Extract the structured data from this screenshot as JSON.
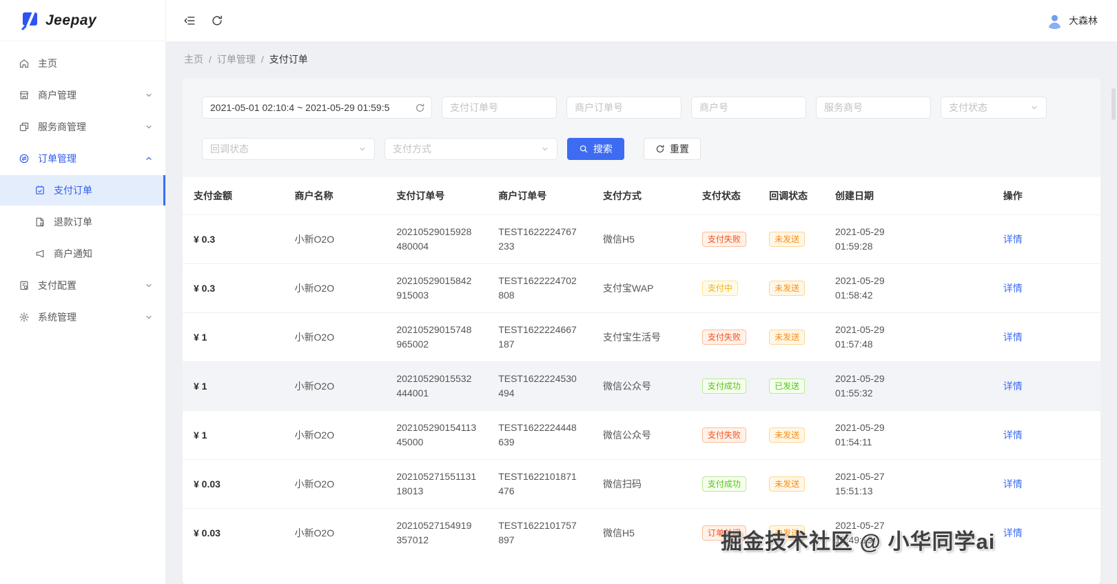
{
  "brand": {
    "name": "Jeepay"
  },
  "topbar": {
    "username": "大森林"
  },
  "breadcrumb": {
    "separator": "/",
    "items": [
      "主页",
      "订单管理",
      "支付订单"
    ]
  },
  "sidebar": {
    "items": [
      {
        "label": "主页"
      },
      {
        "label": "商户管理"
      },
      {
        "label": "服务商管理"
      },
      {
        "label": "订单管理",
        "children": [
          {
            "label": "支付订单"
          },
          {
            "label": "退款订单"
          },
          {
            "label": "商户通知"
          }
        ]
      },
      {
        "label": "支付配置"
      },
      {
        "label": "系统管理"
      }
    ]
  },
  "filters": {
    "date_range_value": "2021-05-01 02:10:4 ~ 2021-05-29 01:59:5",
    "pay_order_no_placeholder": "支付订单号",
    "mch_order_no_placeholder": "商户订单号",
    "mch_no_placeholder": "商户号",
    "isv_no_placeholder": "服务商号",
    "pay_status_placeholder": "支付状态",
    "notify_status_placeholder": "回调状态",
    "pay_way_placeholder": "支付方式",
    "search_label": "搜索",
    "reset_label": "重置"
  },
  "table": {
    "columns": [
      "支付金额",
      "商户名称",
      "支付订单号",
      "商户订单号",
      "支付方式",
      "支付状态",
      "回调状态",
      "创建日期",
      "操作"
    ],
    "action_label": "详情",
    "rows": [
      {
        "amount": "¥ 0.3",
        "merchant": "小新O2O",
        "pay_order_no": "20210529015928480004",
        "mch_order_no": "TEST1622224767233",
        "pay_way": "微信H5",
        "pay_status": {
          "text": "支付失败",
          "type": "error"
        },
        "notify_status": {
          "text": "未发送",
          "type": "warning"
        },
        "created_date": "2021-05-29",
        "created_time": "01:59:28"
      },
      {
        "amount": "¥ 0.3",
        "merchant": "小新O2O",
        "pay_order_no": "20210529015842915003",
        "mch_order_no": "TEST1622224702808",
        "pay_way": "支付宝WAP",
        "pay_status": {
          "text": "支付中",
          "type": "gold"
        },
        "notify_status": {
          "text": "未发送",
          "type": "warning"
        },
        "created_date": "2021-05-29",
        "created_time": "01:58:42"
      },
      {
        "amount": "¥ 1",
        "merchant": "小新O2O",
        "pay_order_no": "20210529015748965002",
        "mch_order_no": "TEST1622224667187",
        "pay_way": "支付宝生活号",
        "pay_status": {
          "text": "支付失败",
          "type": "error"
        },
        "notify_status": {
          "text": "未发送",
          "type": "warning"
        },
        "created_date": "2021-05-29",
        "created_time": "01:57:48"
      },
      {
        "amount": "¥ 1",
        "merchant": "小新O2O",
        "pay_order_no": "20210529015532444001",
        "mch_order_no": "TEST1622224530494",
        "pay_way": "微信公众号",
        "pay_status": {
          "text": "支付成功",
          "type": "success"
        },
        "notify_status": {
          "text": "已发送",
          "type": "success"
        },
        "created_date": "2021-05-29",
        "created_time": "01:55:32"
      },
      {
        "amount": "¥ 1",
        "merchant": "小新O2O",
        "pay_order_no": "20210529015411345000",
        "mch_order_no": "TEST1622224448639",
        "pay_way": "微信公众号",
        "pay_status": {
          "text": "支付失败",
          "type": "error"
        },
        "notify_status": {
          "text": "未发送",
          "type": "warning"
        },
        "created_date": "2021-05-29",
        "created_time": "01:54:11"
      },
      {
        "amount": "¥ 0.03",
        "merchant": "小新O2O",
        "pay_order_no": "20210527155113118013",
        "mch_order_no": "TEST1622101871476",
        "pay_way": "微信扫码",
        "pay_status": {
          "text": "支付成功",
          "type": "success"
        },
        "notify_status": {
          "text": "未发送",
          "type": "warning"
        },
        "created_date": "2021-05-27",
        "created_time": "15:51:13"
      },
      {
        "amount": "¥ 0.03",
        "merchant": "小新O2O",
        "pay_order_no": "20210527154919357012",
        "mch_order_no": "TEST1622101757897",
        "pay_way": "微信H5",
        "pay_status": {
          "text": "订单关闭",
          "type": "error"
        },
        "notify_status": {
          "text": "未发送",
          "type": "warning"
        },
        "created_date": "2021-05-27",
        "created_time": "15:49:19"
      }
    ]
  },
  "watermark": {
    "text": "掘金技术社区 @ 小华同学ai"
  },
  "colors": {
    "primary": "#3d6bf2",
    "success": "#52c41a",
    "warning": "#fa8c16",
    "gold": "#faad14",
    "error": "#f5501e",
    "active_menu_bg": "#e4edfb"
  }
}
